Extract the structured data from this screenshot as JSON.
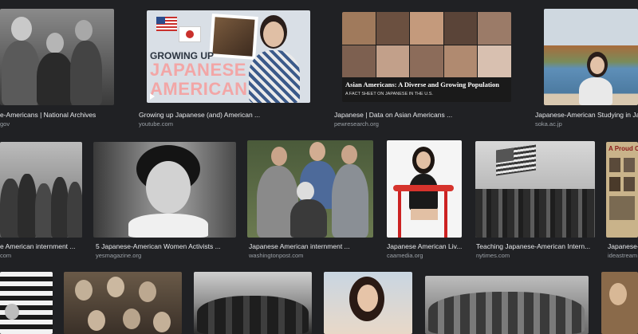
{
  "results": [
    {
      "caption": "e-Americans | National Archives",
      "source": "gov"
    },
    {
      "caption": "Growing up Japanese (and) American ...",
      "source": "youtube.com",
      "overlay_top": "GROWING UP",
      "overlay_main": "JAPANESE",
      "overlay_bottom": "AMERICAN"
    },
    {
      "caption": "Japanese | Data on Asian Americans ...",
      "source": "pewresearch.org",
      "overlay_title": "Asian Americans: A Diverse and Growing Population",
      "overlay_sub": "A FACT SHEET ON JAPANESE IN THE U.S."
    },
    {
      "caption": "Japanese-American Studying in Ja",
      "source": "soka.ac.jp"
    },
    {
      "caption": "e American internment ...",
      "source": "com"
    },
    {
      "caption": "5 Japanese-American Women Activists ...",
      "source": "yesmagazine.org"
    },
    {
      "caption": "Japanese American internment ...",
      "source": "washingtonpost.com"
    },
    {
      "caption": "Japanese American Liv...",
      "source": "caamedia.org"
    },
    {
      "caption": "Teaching Japanese-American Intern...",
      "source": "nytimes.com"
    },
    {
      "caption": "Japanese-",
      "source": "ideastream",
      "overlay_title": "A Proud Ch"
    }
  ],
  "colors": {
    "background": "#202124",
    "caption": "#e8eaed",
    "source": "#9aa0a6",
    "banner_pink": "#f2a6a6"
  },
  "icons": {
    "play": "play-icon"
  }
}
